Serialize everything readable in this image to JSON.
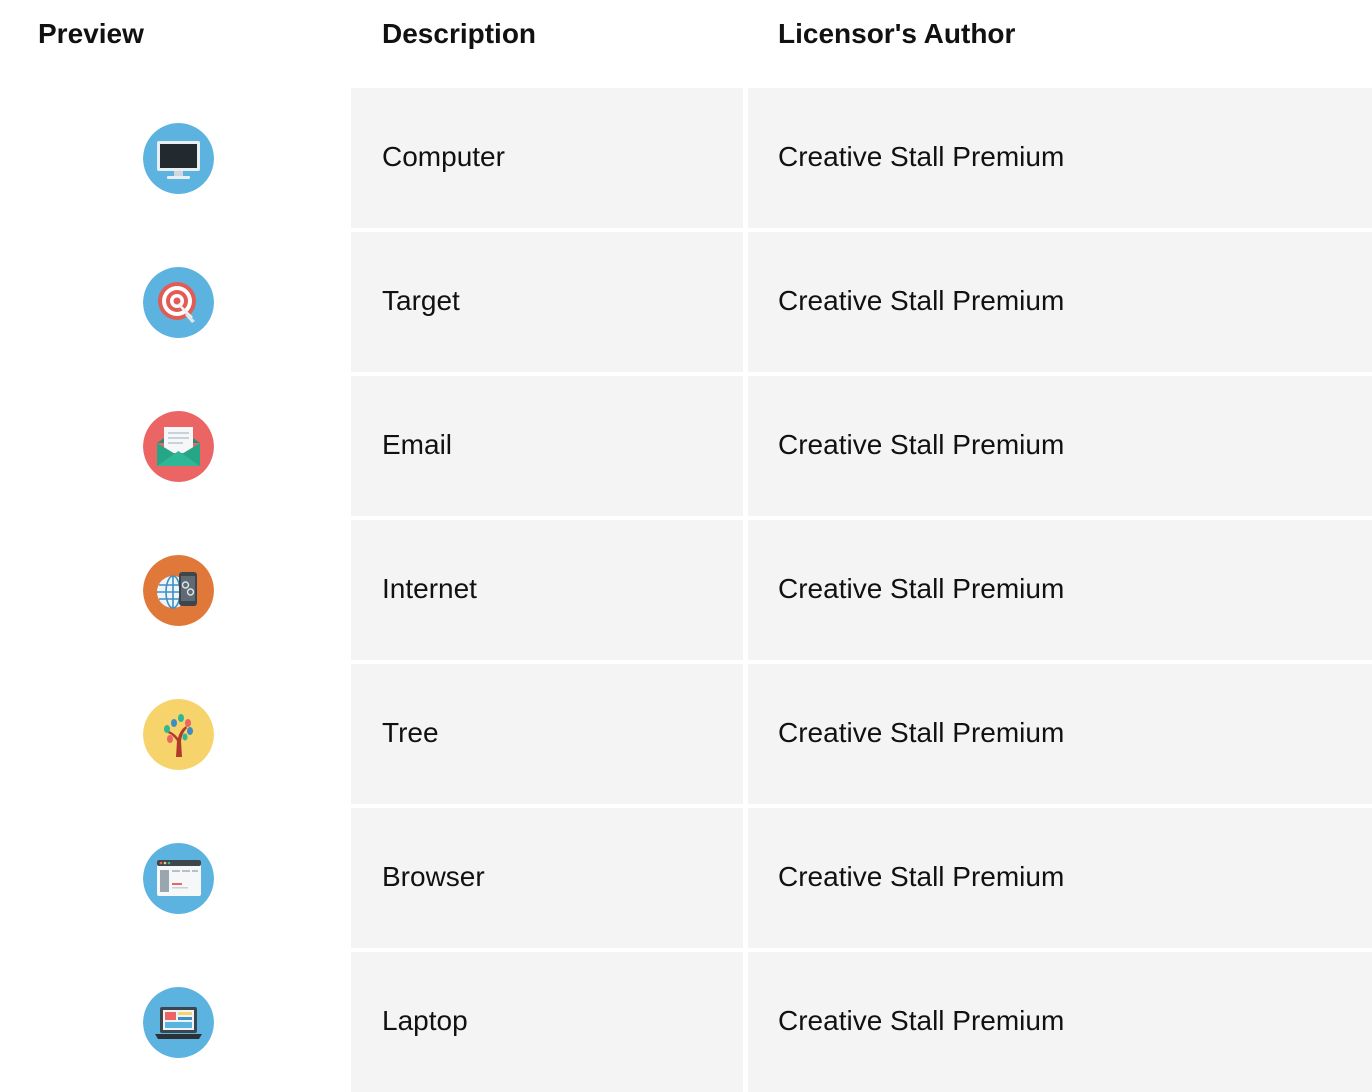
{
  "headers": {
    "preview": "Preview",
    "description": "Description",
    "author": "Licensor's Author"
  },
  "rows": [
    {
      "description": "Computer",
      "author": "Creative Stall Premium",
      "icon": "computer-icon",
      "color": "#5cb3e0"
    },
    {
      "description": "Target",
      "author": "Creative Stall Premium",
      "icon": "target-icon",
      "color": "#5cb3e0"
    },
    {
      "description": "Email",
      "author": "Creative Stall Premium",
      "icon": "email-icon",
      "color": "#eb6565"
    },
    {
      "description": "Internet",
      "author": "Creative Stall Premium",
      "icon": "internet-icon",
      "color": "#e0783a"
    },
    {
      "description": "Tree",
      "author": "Creative Stall Premium",
      "icon": "tree-icon",
      "color": "#f6d36b"
    },
    {
      "description": "Browser",
      "author": "Creative Stall Premium",
      "icon": "browser-icon",
      "color": "#5cb3e0"
    },
    {
      "description": "Laptop",
      "author": "Creative Stall Premium",
      "icon": "laptop-icon",
      "color": "#5cb3e0"
    }
  ]
}
